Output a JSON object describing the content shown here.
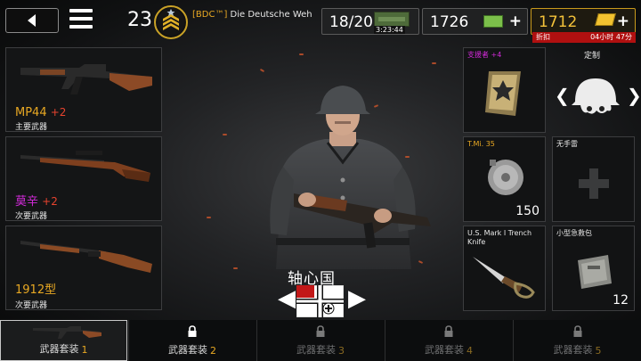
{
  "header": {
    "rank_level": "23",
    "clan_tag": "[BDC™]",
    "player_name": "Die Deutsche Weh"
  },
  "resources": {
    "energy": "18/20",
    "energy_timer": "3:23:44",
    "money": "1726",
    "gold": "1712",
    "discount_label": "折扣",
    "discount_time": "04小时 47分"
  },
  "weapons": [
    {
      "name": "MP44",
      "bonus": "+2",
      "slot": "主要武器"
    },
    {
      "name": "莫辛",
      "bonus": "+2",
      "slot": "次要武器"
    },
    {
      "name": "1912型",
      "bonus": "",
      "slot": "次要武器"
    }
  ],
  "equipment": {
    "supporter": {
      "label": "支援者",
      "bonus": "+4"
    },
    "custom": {
      "label": "定制"
    },
    "grenade": {
      "label": "T.Mi. 35",
      "count": "150"
    },
    "grenade_empty": {
      "label": "无手雷"
    },
    "knife": {
      "label": "U.S. Mark I Trench Knife"
    },
    "medkit": {
      "label": "小型急救包",
      "count": "12"
    }
  },
  "faction": {
    "name": "轴心国"
  },
  "tabs": [
    {
      "label": "武器套装",
      "num": "1"
    },
    {
      "label": "武器套装",
      "num": "2"
    },
    {
      "label": "武器套装",
      "num": "3"
    },
    {
      "label": "武器套装",
      "num": "4"
    },
    {
      "label": "武器套装",
      "num": "5"
    }
  ],
  "colors": {
    "accent_gold": "#e8a823",
    "upgrade_red": "#e8432e",
    "rare_purple": "#d22ad9"
  }
}
